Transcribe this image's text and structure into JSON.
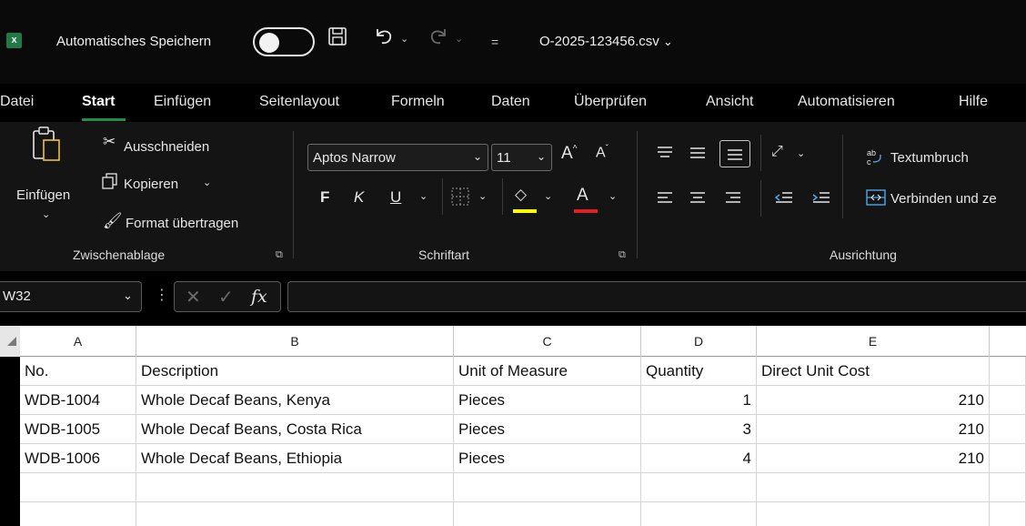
{
  "titlebar": {
    "app_badge": "x",
    "autosave_label": "Automatisches Speichern",
    "filename": "O-2025-123456.csv",
    "filename_chevron": "✓"
  },
  "menu": {
    "items": [
      "Datei",
      "Start",
      "Einfügen",
      "Seitenlayout",
      "Formeln",
      "Daten",
      "Überprüfen",
      "Ansicht",
      "Automatisieren",
      "Hilfe"
    ],
    "active": "Start"
  },
  "ribbon": {
    "clipboard": {
      "paste_label": "Einfügen",
      "cut_label": "Ausschneiden",
      "copy_label": "Kopieren",
      "format_painter_label": "Format übertragen",
      "group_label": "Zwischenablage"
    },
    "font": {
      "font_name": "Aptos Narrow",
      "font_size": "11",
      "bold": "F",
      "italic": "K",
      "underline": "U",
      "group_label": "Schriftart",
      "highlight_color": "#ffff00",
      "font_color": "#e0201c"
    },
    "alignment": {
      "wrap_label": "Textumbruch",
      "merge_label": "Verbinden und ze",
      "group_label": "Ausrichtung"
    }
  },
  "formula_bar": {
    "name_box": "W32",
    "fx": "fx",
    "value": ""
  },
  "sheet": {
    "columns": [
      "A",
      "B",
      "C",
      "D",
      "E"
    ],
    "rows": [
      [
        "No.",
        "Description",
        "Unit of Measure",
        "Quantity",
        "Direct Unit Cost"
      ],
      [
        "WDB-1004",
        "Whole Decaf Beans, Kenya",
        "Pieces",
        "1",
        "210"
      ],
      [
        "WDB-1005",
        "Whole Decaf Beans, Costa Rica",
        "Pieces",
        "3",
        "210"
      ],
      [
        "WDB-1006",
        "Whole Decaf Beans, Ethiopia",
        "Pieces",
        "4",
        "210"
      ],
      [
        "",
        "",
        "",
        "",
        ""
      ],
      [
        "",
        "",
        "",
        "",
        ""
      ]
    ]
  }
}
